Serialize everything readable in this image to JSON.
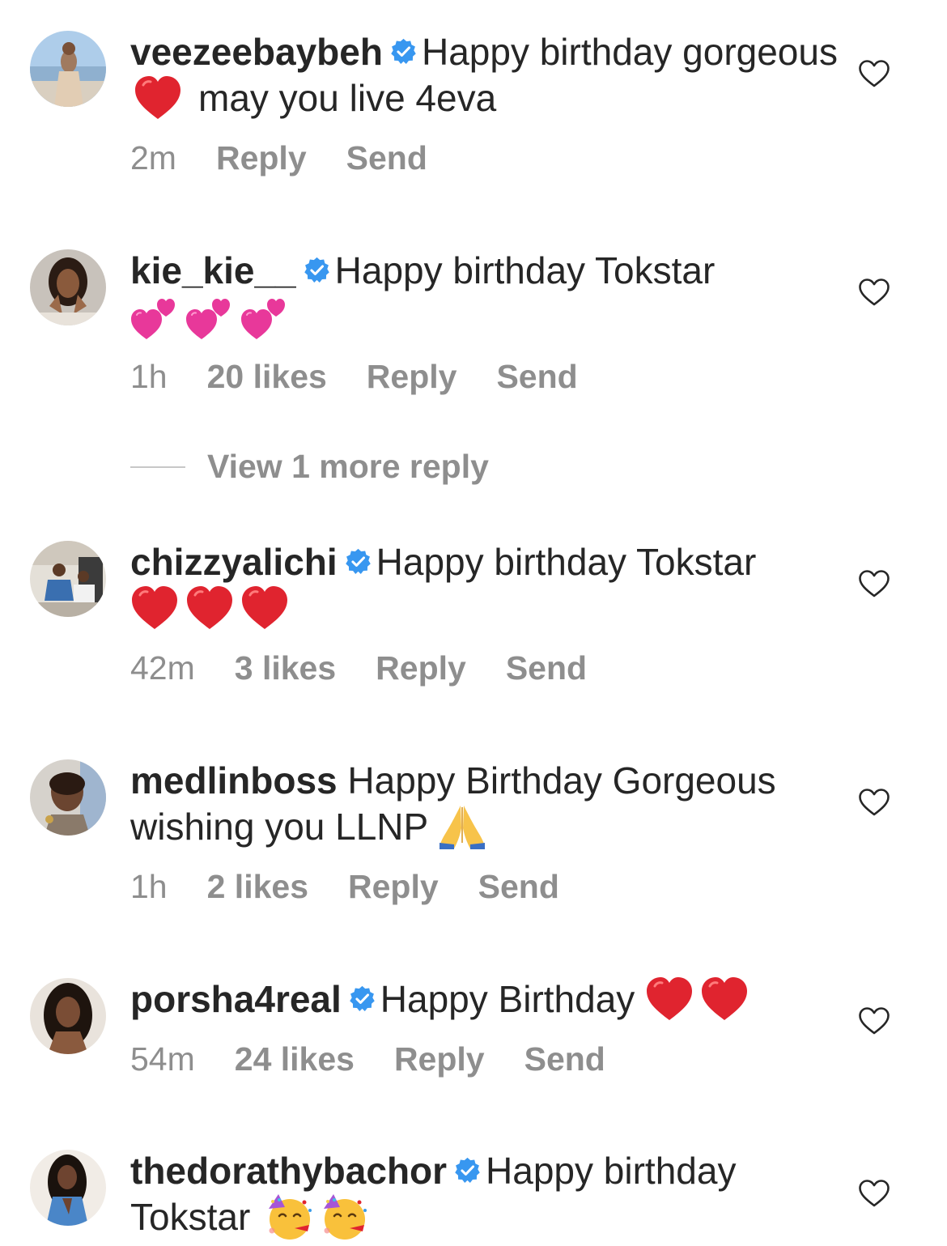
{
  "comments": [
    {
      "username": "veezeebaybeh",
      "verified": true,
      "text_parts": [
        "Happy birthday gorgeous",
        "may you live 4eva"
      ],
      "emojis": [
        "red-heart"
      ],
      "time": "2m",
      "likes": "",
      "reply_label": "Reply",
      "send_label": "Send"
    },
    {
      "username": "kie_kie__",
      "verified": true,
      "text_parts": [
        "Happy birthday Tokstar"
      ],
      "emojis": [
        "two-hearts",
        "two-hearts",
        "two-hearts"
      ],
      "time": "1h",
      "likes": "20 likes",
      "reply_label": "Reply",
      "send_label": "Send"
    },
    {
      "username": "chizzyalichi",
      "verified": true,
      "text_parts": [
        "Happy birthday Tokstar"
      ],
      "emojis": [
        "red-heart",
        "red-heart",
        "red-heart"
      ],
      "time": "42m",
      "likes": "3 likes",
      "reply_label": "Reply",
      "send_label": "Send"
    },
    {
      "username": "medlinboss",
      "verified": false,
      "text_parts": [
        "Happy Birthday Gorgeous wishing you LLNP"
      ],
      "emojis": [
        "folded-hands"
      ],
      "time": "1h",
      "likes": "2 likes",
      "reply_label": "Reply",
      "send_label": "Send"
    },
    {
      "username": "porsha4real",
      "verified": true,
      "text_parts": [
        "Happy Birthday"
      ],
      "emojis": [
        "red-heart",
        "red-heart"
      ],
      "time": "54m",
      "likes": "24 likes",
      "reply_label": "Reply",
      "send_label": "Send"
    },
    {
      "username": "thedorathybachor",
      "verified": true,
      "text_parts": [
        "Happy birthday",
        "Tokstar"
      ],
      "emojis": [
        "partying-face",
        "partying-face"
      ],
      "time": "",
      "likes": "",
      "reply_label": "",
      "send_label": ""
    }
  ],
  "view_replies": {
    "label": "View 1 more reply"
  },
  "colors": {
    "text": "#262626",
    "secondary": "#8e8e8e",
    "verified_blue": "#3897f0",
    "heart_red": "#e0242f",
    "pink_heart": "#e8389a",
    "divider": "#c7c7c7"
  },
  "icons": {
    "like": "heart-outline-icon",
    "verified": "verified-badge-icon"
  }
}
